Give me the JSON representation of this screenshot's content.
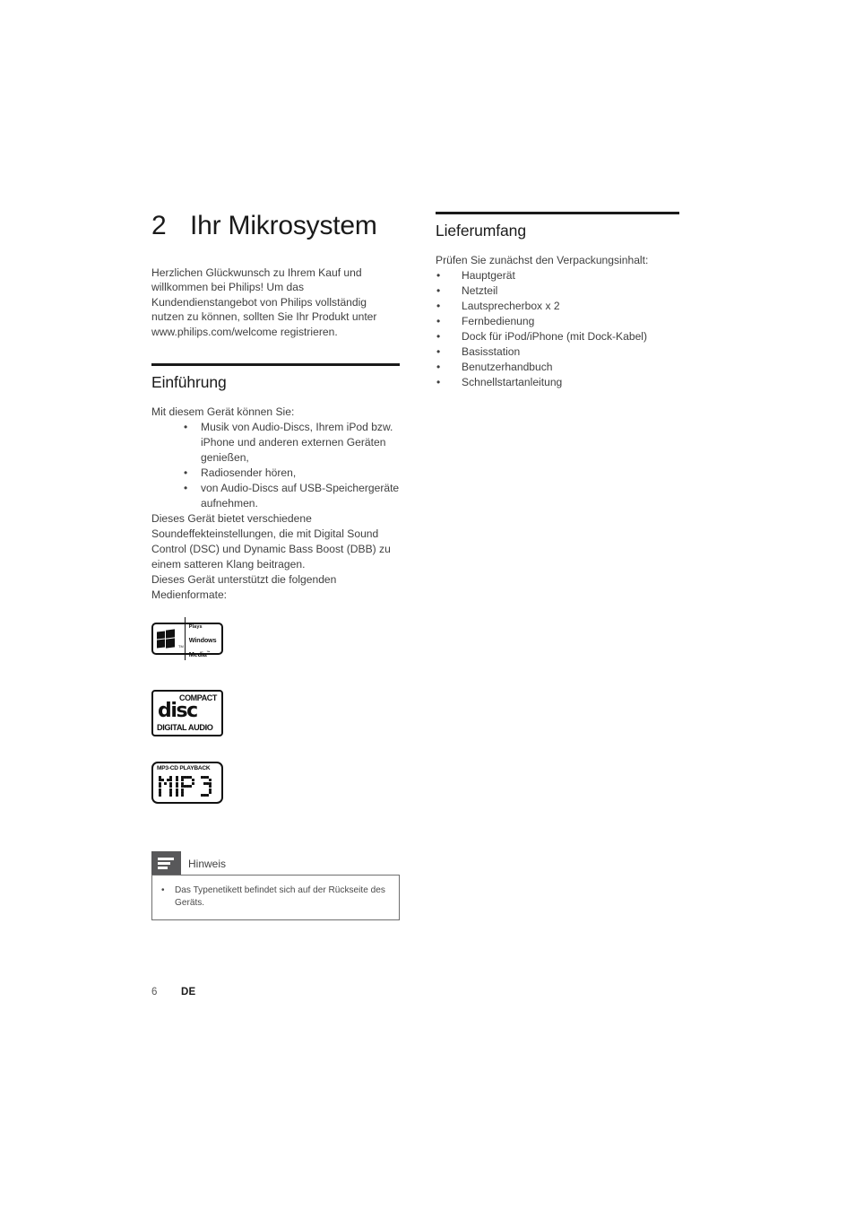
{
  "chapter": {
    "number": "2",
    "title": "Ihr Mikrosystem",
    "intro": "Herzlichen Glückwunsch zu Ihrem Kauf und willkommen bei Philips! Um das Kundendienstangebot von Philips vollständig nutzen zu können, sollten Sie Ihr Produkt unter www.philips.com/welcome registrieren."
  },
  "einfuehrung": {
    "heading": "Einführung",
    "lead": "Mit diesem Gerät können Sie:",
    "bullets": [
      "Musik von Audio-Discs, Ihrem iPod bzw. iPhone und anderen externen Geräten genießen,",
      "Radiosender hören,",
      "von Audio-Discs auf USB-Speichergeräte aufnehmen."
    ],
    "para2": "Dieses Gerät bietet verschiedene Soundeffekteinstellungen, die mit Digital Sound Control (DSC) und Dynamic Bass Boost (DBB) zu einem satteren Klang beitragen.",
    "para3": "Dieses Gerät unterstützt die folgenden Medienformate:"
  },
  "logos": {
    "wmp": {
      "name": "plays-windows-media-logo",
      "line1": "Plays",
      "line2": "Windows",
      "line3": "Media",
      "tm": "™",
      "tm_small": "TM"
    },
    "cd": {
      "name": "compact-disc-digital-audio-logo",
      "compact": "COMPACT",
      "disc": "disc",
      "bottom": "DIGITAL AUDIO"
    },
    "mp3": {
      "name": "mp3-cd-playback-logo",
      "top": "MP3-CD PLAYBACK",
      "word": "MP3"
    }
  },
  "note": {
    "icon": "note-icon",
    "title": "Hinweis",
    "items": [
      "Das Typenetikett befindet sich auf der Rückseite des Geräts."
    ]
  },
  "lieferumfang": {
    "heading": "Lieferumfang",
    "lead": "Prüfen Sie zunächst den Verpackungsinhalt:",
    "bullets": [
      "Hauptgerät",
      "Netzteil",
      "Lautsprecherbox x 2",
      "Fernbedienung",
      "Dock für iPod/iPhone (mit Dock-Kabel)",
      "Basisstation",
      "Benutzerhandbuch",
      "Schnellstartanleitung"
    ]
  },
  "footer": {
    "page_number": "6",
    "language": "DE"
  },
  "bullet_glyph": "•",
  "colors": {
    "text": "#3f3f3f",
    "heading": "#1a1a1a",
    "rule": "#1a1a1a",
    "note_icon_bg": "#58585a",
    "note_border": "#6f6f6f"
  }
}
